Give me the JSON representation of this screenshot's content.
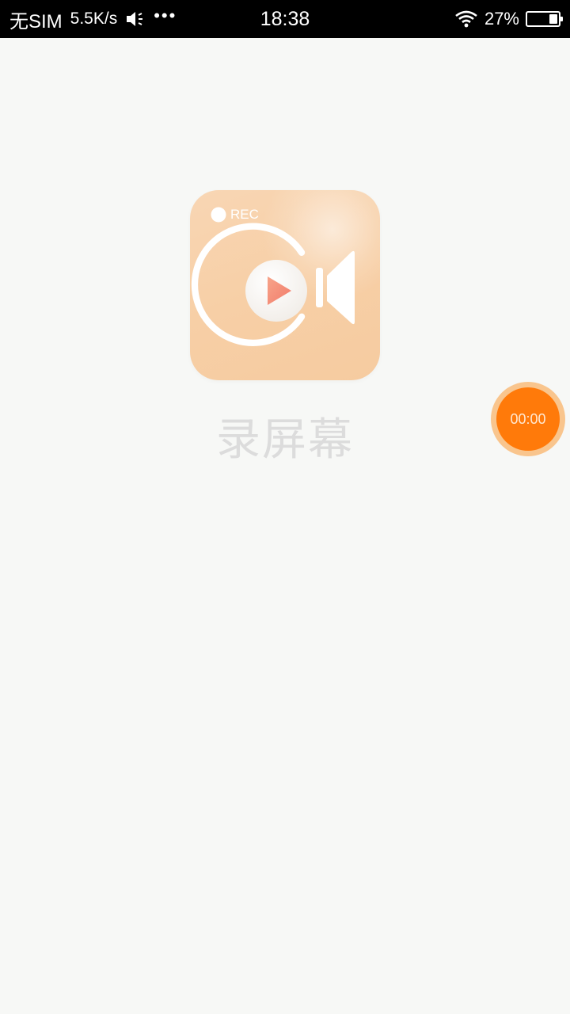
{
  "status_bar": {
    "carrier": "无SIM",
    "net_speed": "5.5K/s",
    "speaker_icon": "speaker-vibrate-icon",
    "more_dots": "•••",
    "time": "18:38",
    "wifi_icon": "wifi-icon",
    "battery_percent": "27%",
    "battery_level": 0.27
  },
  "splash": {
    "icon_badge": "REC",
    "icon": "screen-recorder-app-icon",
    "app_name": "录屏幕"
  },
  "floating_timer": {
    "time": "00:00"
  },
  "colors": {
    "background": "#f7f8f6",
    "icon_peach": "#f7cfa6",
    "timer_orange": "#ff7a0a",
    "timer_ring": "#f9c58d",
    "app_name_text": "#dcdcdc"
  }
}
